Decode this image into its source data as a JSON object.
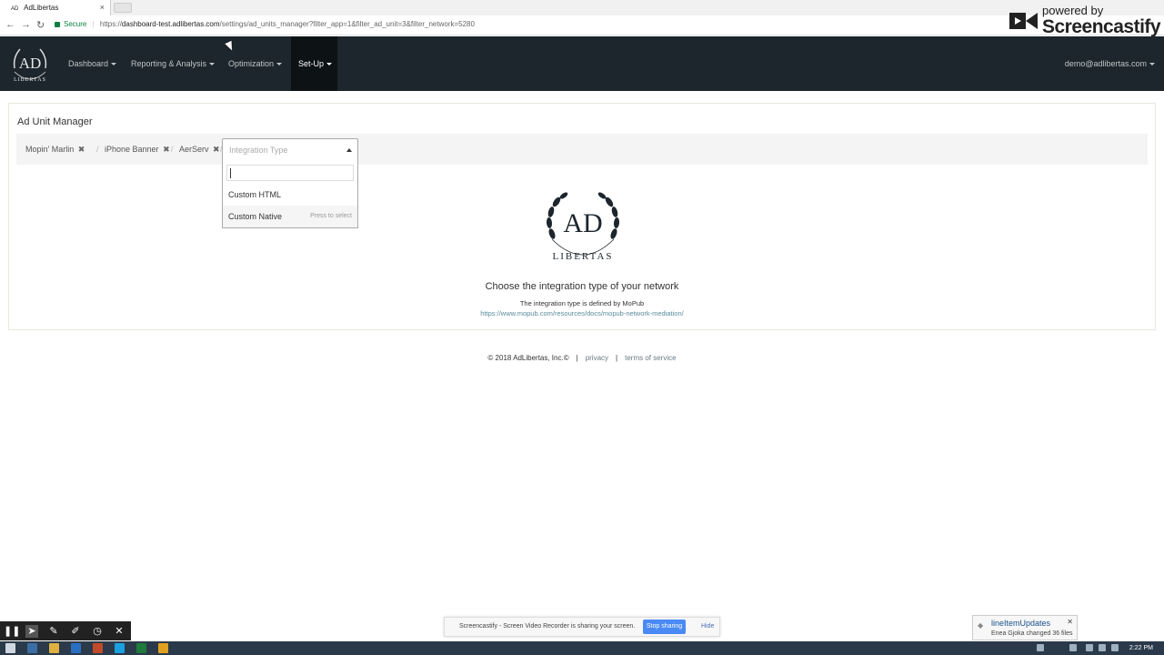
{
  "browser": {
    "tab_title": "AdLibertas",
    "tab_close": "×",
    "tab_favicon_text": "AD",
    "secure_label": "Secure",
    "url_scheme": "https://",
    "url_host": "dashboard-test.adlibertas.com",
    "url_path": "/settings/ad_units_manager?filter_app=1&filter_ad_unit=3&filter_network=5280",
    "back_icon": "←",
    "forward_icon": "→",
    "reload_icon": "↻"
  },
  "watermark": {
    "line1": "powered by",
    "line2": "Screencastify"
  },
  "navbar": {
    "items": [
      {
        "label": "Dashboard"
      },
      {
        "label": "Reporting & Analysis"
      },
      {
        "label": "Optimization"
      },
      {
        "label": "Set-Up"
      }
    ],
    "user": "demo@adlibertas.com"
  },
  "page": {
    "title": "Ad Unit Manager",
    "crumbs": [
      {
        "label": "Mopin' Marlin",
        "remove": "✖"
      },
      {
        "label": "iPhone Banner",
        "remove": "✖"
      },
      {
        "label": "AerServ",
        "remove": "✖"
      }
    ],
    "crumb_separator": "/",
    "select": {
      "placeholder": "Integration Type",
      "options": [
        {
          "label": "Custom HTML"
        },
        {
          "label": "Custom Native",
          "hint": "Press to select"
        }
      ]
    },
    "heading": "Choose the integration type of your network",
    "defined_by": "The integration type is defined by MoPub",
    "doc_link": "https://www.mopub.com/resources/docs/mopub-network-mediation/"
  },
  "footer": {
    "copyright": "© 2018 AdLibertas, Inc.©",
    "separator": "|",
    "privacy": "privacy",
    "terms": "terms of service"
  },
  "screencastify": {
    "tools": [
      "❚❚",
      "➤",
      "✎",
      "✐",
      "◷",
      "✕"
    ],
    "sharing_message": "Screencastify - Screen Video Recorder is sharing your screen.",
    "stop_label": "Stop sharing",
    "hide_label": "Hide"
  },
  "toast": {
    "title": "lineItemUpdates",
    "body": "Enea Gjoka changed 36 files",
    "close": "✕"
  },
  "taskbar": {
    "clock": "2:22 PM"
  }
}
